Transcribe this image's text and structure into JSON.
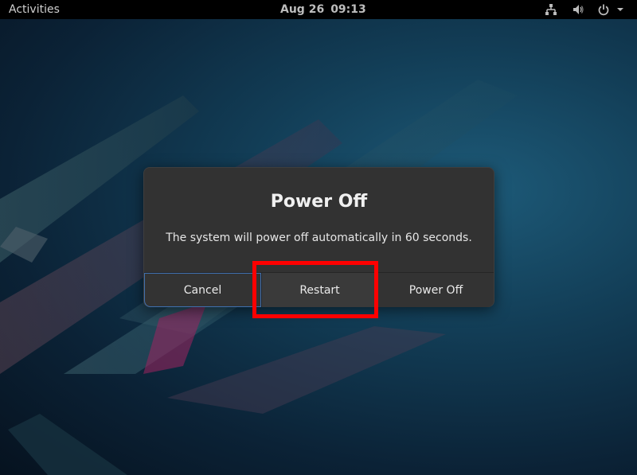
{
  "topbar": {
    "activities_label": "Activities",
    "date": "Aug 26",
    "time": "09:13",
    "tray_icons": [
      "network-wired-icon",
      "volume-icon",
      "power-icon",
      "chevron-down-icon"
    ]
  },
  "dialog": {
    "title": "Power Off",
    "message": "The system will power off automatically in 60 seconds.",
    "buttons": {
      "cancel": "Cancel",
      "restart": "Restart",
      "power_off": "Power Off"
    }
  },
  "annotation": {
    "highlight_color": "#ff0000",
    "highlighted": "restart"
  },
  "colors": {
    "topbar_bg": "#000000",
    "dialog_bg": "#323232",
    "focus_border": "#3f6fae"
  }
}
